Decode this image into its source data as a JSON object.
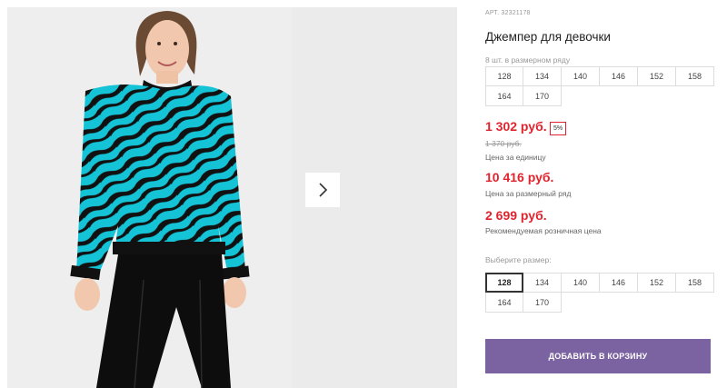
{
  "product": {
    "article": "АРТ. 32321178",
    "title": "Джемпер для девочки"
  },
  "pack_sizes": {
    "label": "8 шт. в размерном ряду",
    "sizes": [
      "128",
      "134",
      "140",
      "146",
      "152",
      "158",
      "164",
      "170"
    ]
  },
  "prices": {
    "current": "1 302 руб.",
    "discount_badge": "5%",
    "old": "1 370 руб.",
    "unit_caption": "Цена за единицу",
    "set_price": "10 416 руб.",
    "set_caption": "Цена за размерный ряд",
    "rrp_price": "2 699 руб.",
    "rrp_caption": "Рекомендуемая розничная цена",
    "accent_color": "#e0242e"
  },
  "size_select": {
    "label": "Выберите размер:",
    "sizes": [
      "128",
      "134",
      "140",
      "146",
      "152",
      "158",
      "164",
      "170"
    ],
    "selected": "128"
  },
  "cart": {
    "button_label": "ДОБАВИТЬ В КОРЗИНУ",
    "button_color": "#7b63a1"
  },
  "gallery": {
    "next_icon": "chevron-right-icon",
    "photo_subject": "product-photo"
  }
}
